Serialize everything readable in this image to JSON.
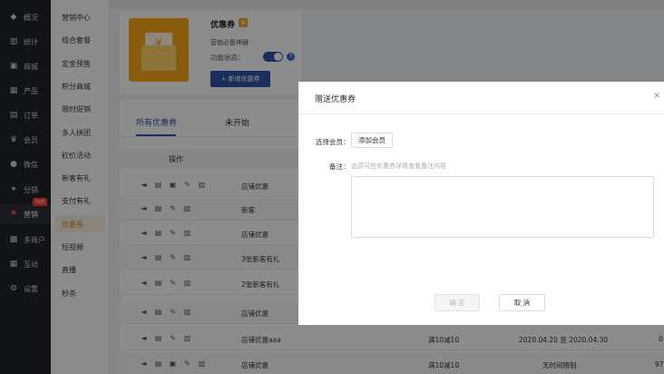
{
  "sidebar_main": [
    {
      "label": "概况",
      "icon": "layers-icon"
    },
    {
      "label": "统计",
      "icon": "chart-icon"
    },
    {
      "label": "商城",
      "icon": "shop-icon"
    },
    {
      "label": "产品",
      "icon": "grid-icon"
    },
    {
      "label": "订单",
      "icon": "order-icon"
    },
    {
      "label": "会员",
      "icon": "crown-icon"
    },
    {
      "label": "微信",
      "icon": "wechat-icon"
    },
    {
      "label": "分销",
      "icon": "share-icon"
    },
    {
      "label": "营销",
      "icon": "flag-icon",
      "badge": "hot"
    },
    {
      "label": "多商户",
      "icon": "merchant-icon"
    },
    {
      "label": "互动",
      "icon": "grid-icon"
    },
    {
      "label": "设置",
      "icon": "gear-icon"
    }
  ],
  "sidebar_sub": [
    "营销中心",
    "组合套餐",
    "定金预售",
    "积分商城",
    "限时促销",
    "多人拼团",
    "砍价活动",
    "新客有礼",
    "支付有礼",
    "优惠券",
    "短视频",
    "直播",
    "秒杀"
  ],
  "card": {
    "title": "优惠券",
    "badge_icon": "vip-icon",
    "subtitle": "营销必备神器",
    "status_label": "功能状态：",
    "new_button": "+ 新增优惠券"
  },
  "tabs": [
    "所有优惠券",
    "未开始"
  ],
  "table": {
    "headers": [
      "操作"
    ],
    "rows": [
      {
        "name": "店铺优惠",
        "cond": "",
        "time": ""
      },
      {
        "name": "新客",
        "cond": "",
        "time": ""
      },
      {
        "name": "店铺优惠",
        "cond": "",
        "time": ""
      },
      {
        "name": "3张新客有礼",
        "cond": "",
        "time": ""
      },
      {
        "name": "2张新客有礼",
        "cond": "",
        "time": ""
      },
      {
        "name": "店铺优惠",
        "cond": "",
        "time": ""
      },
      {
        "name": "店铺优惠aaa",
        "cond": "满10减10",
        "time": "2020.04.20 至 2020.04.30",
        "extra": "0"
      },
      {
        "name": "店铺优惠",
        "cond": "满10减10",
        "time": "无时间限制",
        "extra": "97"
      }
    ]
  },
  "modal": {
    "title": "赠送优惠券",
    "close": "×",
    "member_label": "选择会员：",
    "add_member": "添加会员",
    "note_label": "备注：",
    "note_hint": "会员可在优惠券详情查看备注内容",
    "ok": "确 定",
    "cancel": "取 消"
  }
}
